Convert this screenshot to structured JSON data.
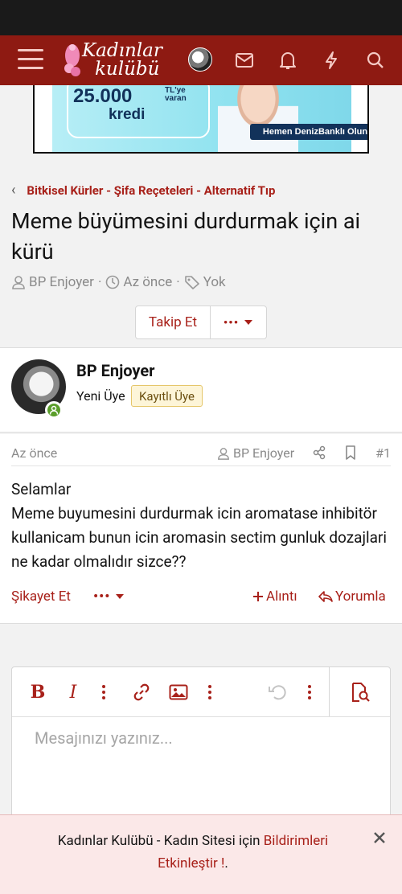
{
  "header": {
    "logo_line1": "Kadınlar",
    "logo_line2": "kulübü"
  },
  "ad": {
    "amount": "25.000",
    "amount_suffix_line1": "TL'ye",
    "amount_suffix_line2": "varan",
    "product": "kredi",
    "cta": "Hemen DenizBanklı Olun"
  },
  "breadcrumb": {
    "label": "Bitkisel Kürler - Şifa Reçeteleri - Alternatif Tıp"
  },
  "thread": {
    "title": "Meme büyümesini durdurmak için ai kürü",
    "author": "BP Enjoyer",
    "time": "Az önce",
    "tags": "Yok"
  },
  "actions": {
    "follow": "Takip Et",
    "more": "•••"
  },
  "user": {
    "name": "BP Enjoyer",
    "title": "Yeni Üye",
    "badge": "Kayıtlı Üye"
  },
  "post": {
    "date": "Az önce",
    "author": "BP Enjoyer",
    "number": "#1",
    "body_line1": "Selamlar",
    "body_line2": "Meme buyumesini durdurmak icin aromatase inhibitör kullanicam bunun icin aromasin sectim gunluk dozajlari ne kadar olmalıdır sizce??",
    "report": "Şikayet Et",
    "more": "•••",
    "quote": "Alıntı",
    "reply": "Yorumla"
  },
  "editor": {
    "placeholder": "Mesajınızı yazınız..."
  },
  "notice": {
    "text": "Kadınlar Kulübü - Kadın Sitesi için ",
    "link": "Bildirimleri Etkinleştir !",
    "suffix": "."
  },
  "colors": {
    "brand": "#8e1a12",
    "accent": "#a8211a",
    "online": "#5a9e2a"
  }
}
